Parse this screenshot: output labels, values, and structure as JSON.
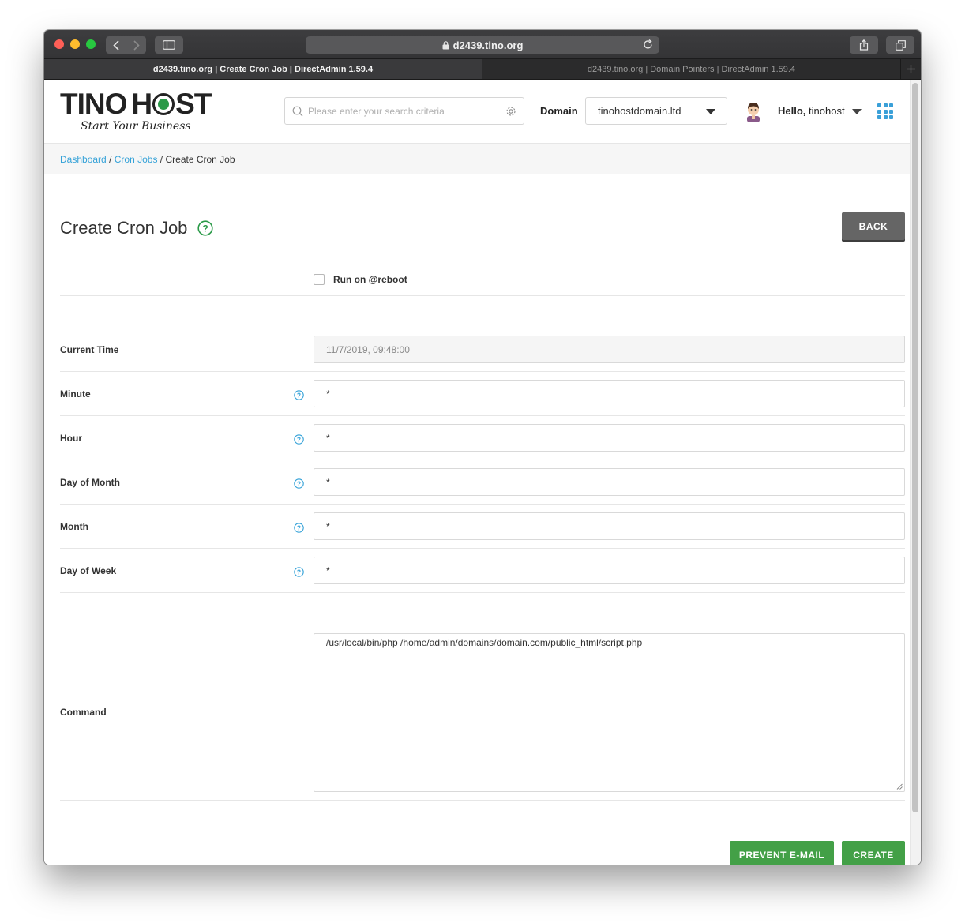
{
  "browser": {
    "address": "d2439.tino.org",
    "tabs": [
      {
        "label": "d2439.tino.org | Create Cron Job | DirectAdmin 1.59.4",
        "active": true
      },
      {
        "label": "d2439.tino.org | Domain Pointers | DirectAdmin 1.59.4",
        "active": false
      }
    ]
  },
  "header": {
    "logo_text_left": "TIN",
    "logo_text_mid": "H",
    "logo_text_right": "ST",
    "logo_tagline": "Start Your Business",
    "search_placeholder": "Please enter your search criteria",
    "domain_label": "Domain",
    "domain_selected": "tinohostdomain.ltd",
    "hello_prefix": "Hello,",
    "username": "tinohost"
  },
  "breadcrumb": {
    "items": [
      "Dashboard",
      "Cron Jobs"
    ],
    "separator": "/",
    "current": "Create Cron Job"
  },
  "page": {
    "title": "Create Cron Job",
    "back_label": "BACK",
    "reboot_label": "Run on @reboot",
    "reboot_checked": false
  },
  "form": {
    "current_time": {
      "label": "Current Time",
      "value": "11/7/2019, 09:48:00"
    },
    "minute": {
      "label": "Minute",
      "value": "*"
    },
    "hour": {
      "label": "Hour",
      "value": "*"
    },
    "day_of_month": {
      "label": "Day of Month",
      "value": "*"
    },
    "month": {
      "label": "Month",
      "value": "*"
    },
    "day_of_week": {
      "label": "Day of Week",
      "value": "*"
    },
    "command": {
      "label": "Command",
      "value": "/usr/local/bin/php /home/admin/domains/domain.com/public_html/script.php"
    }
  },
  "actions": {
    "prevent_email_label": "PREVENT E-MAIL",
    "create_label": "CREATE"
  },
  "colors": {
    "accent_link": "#35a2d8",
    "primary_green": "#43a047",
    "back_gray": "#656565",
    "help_green": "#2a9a48",
    "help_blue": "#35a2d8"
  }
}
